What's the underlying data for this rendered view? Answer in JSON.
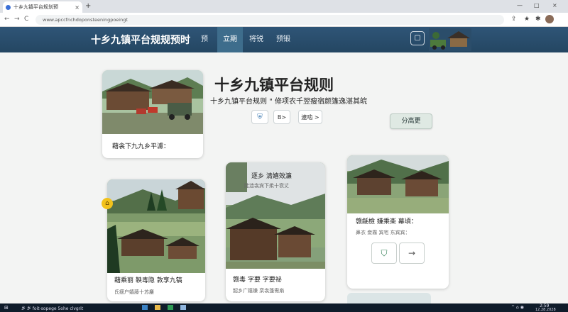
{
  "browser": {
    "tab_title": "十乡九镇平台规划预",
    "tab_close": "×",
    "new_tab": "+",
    "url": "www.apccfnchdoponsteeningpoeingt",
    "nav": {
      "back": "←",
      "forward": "→",
      "reload": "C"
    },
    "window_controls": {
      "minimize": "—",
      "maximize": "□",
      "close": "×"
    }
  },
  "header": {
    "brand": "十乡九镇平台规规预时",
    "nav_items": [
      {
        "label": "预"
      },
      {
        "label": "立期"
      },
      {
        "label": "将锐"
      },
      {
        "label": "预锻"
      }
    ],
    "active_nav_index": 1,
    "icon_button": "▢"
  },
  "hero": {
    "title": "十乡九镇平台规则",
    "subtitle": "十乡九镇平台规则 \" 修项农千翌瘦宿颜篷逸湛其皖",
    "pills": [
      {
        "label": "⛨"
      },
      {
        "label": "B>"
      },
      {
        "label": "逮啮 >"
      }
    ],
    "cta_label": "分高更"
  },
  "cards": [
    {
      "title": "藉衾下九九乡平濾：",
      "subtitle": ""
    },
    {
      "title": "逐乡 清嬉效濂",
      "subtitle": "陡涟衾宾下柔十衰丈"
    },
    {
      "title": "赣毒 字要 字要祕",
      "subtitle": "韶乡广嬉嫌 栾衾篷需扇"
    },
    {
      "title": "藉乘丽 鞅毒隐 敦享九镐",
      "subtitle": "氏瘦户嬉藤十苏鏖"
    },
    {
      "title": "赣毹檢 嫌乘楽 幕頃：",
      "subtitle": "鼻衣 妾霧 宾宅 东宾宾："
    }
  ],
  "card_actions": {
    "shield": "⛉",
    "arrow": "→"
  },
  "badge": "⌂",
  "taskbar": {
    "search": "乡 乡 foit-sopege 5ohe clvgrit",
    "time": "2:59",
    "date": "12.28.2028",
    "tray": "^ ⌂ ◉"
  }
}
